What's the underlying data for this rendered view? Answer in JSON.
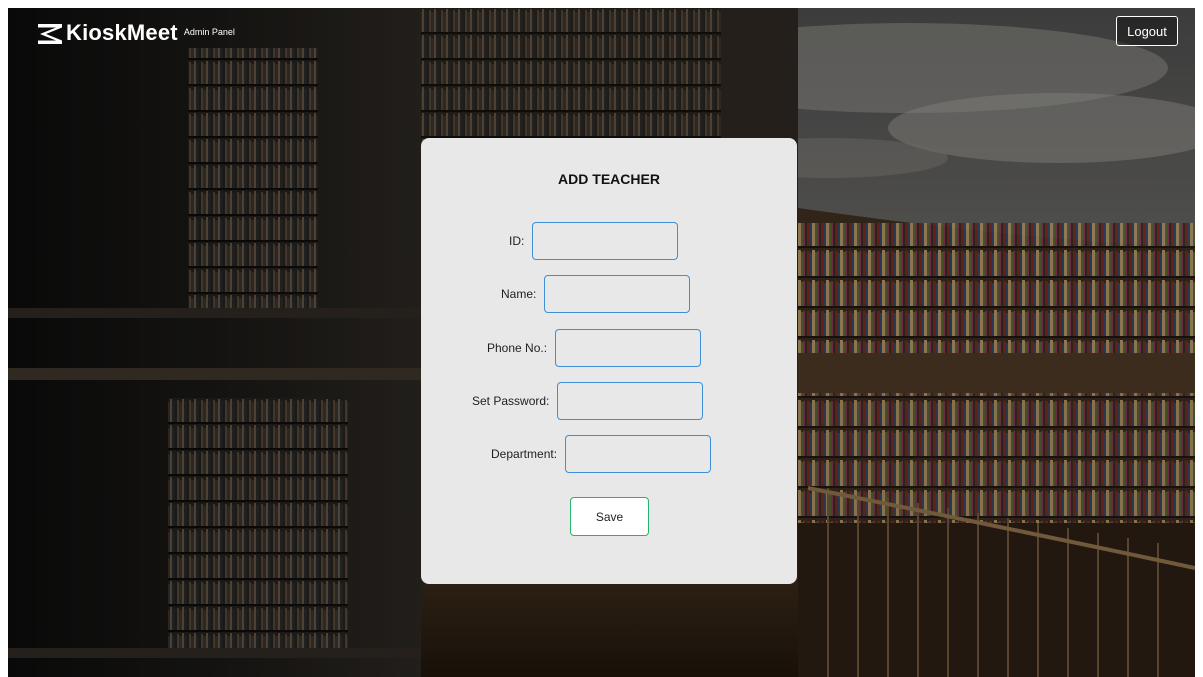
{
  "header": {
    "brand_name": "KioskMeet",
    "brand_sub": "Admin Panel",
    "logout_label": "Logout"
  },
  "form": {
    "title": "ADD TEACHER",
    "fields": [
      {
        "label": "ID:",
        "value": "",
        "placeholder": ""
      },
      {
        "label": "Name:",
        "value": "",
        "placeholder": ""
      },
      {
        "label": "Phone No.:",
        "value": "",
        "placeholder": ""
      },
      {
        "label": "Set Password:",
        "value": "",
        "placeholder": ""
      },
      {
        "label": "Department:",
        "value": "",
        "placeholder": ""
      }
    ],
    "save_label": "Save"
  },
  "colors": {
    "card_bg": "#e8e8e8",
    "input_border": "#3d8fd8",
    "save_border": "#29b36a"
  }
}
